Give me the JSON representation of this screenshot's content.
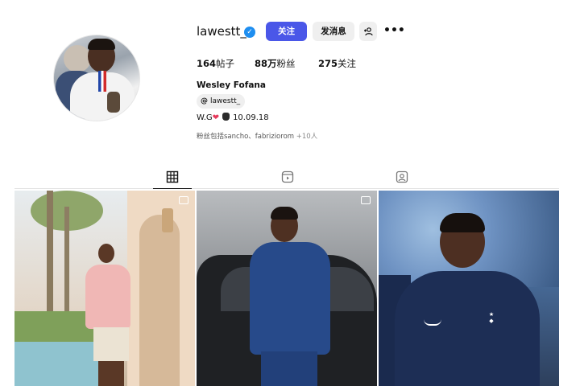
{
  "profile": {
    "username": "lawestt_",
    "verified_icon": "verified-badge-icon",
    "buttons": {
      "follow": "关注",
      "message": "发消息",
      "add_user": "+ ",
      "more": "•••"
    },
    "stats": {
      "posts_count": "164",
      "posts_label": "帖子",
      "followers_count": "88万",
      "followers_label": "粉丝",
      "following_count": "275",
      "following_label": "关注"
    },
    "full_name": "Wesley Fofana",
    "threads_handle": "lawestt_",
    "bio_prefix": "W.G",
    "bio_date": "10.09.18",
    "followed_by_text": "粉丝包括sancho、fabriziorom",
    "followed_by_more": " +10人"
  },
  "tabs": [
    "posts-tab",
    "reels-tab",
    "tagged-tab"
  ],
  "colors": {
    "follow_button": "#4a57e8",
    "verified": "#1e8ef0",
    "heart": "#e5395b"
  }
}
